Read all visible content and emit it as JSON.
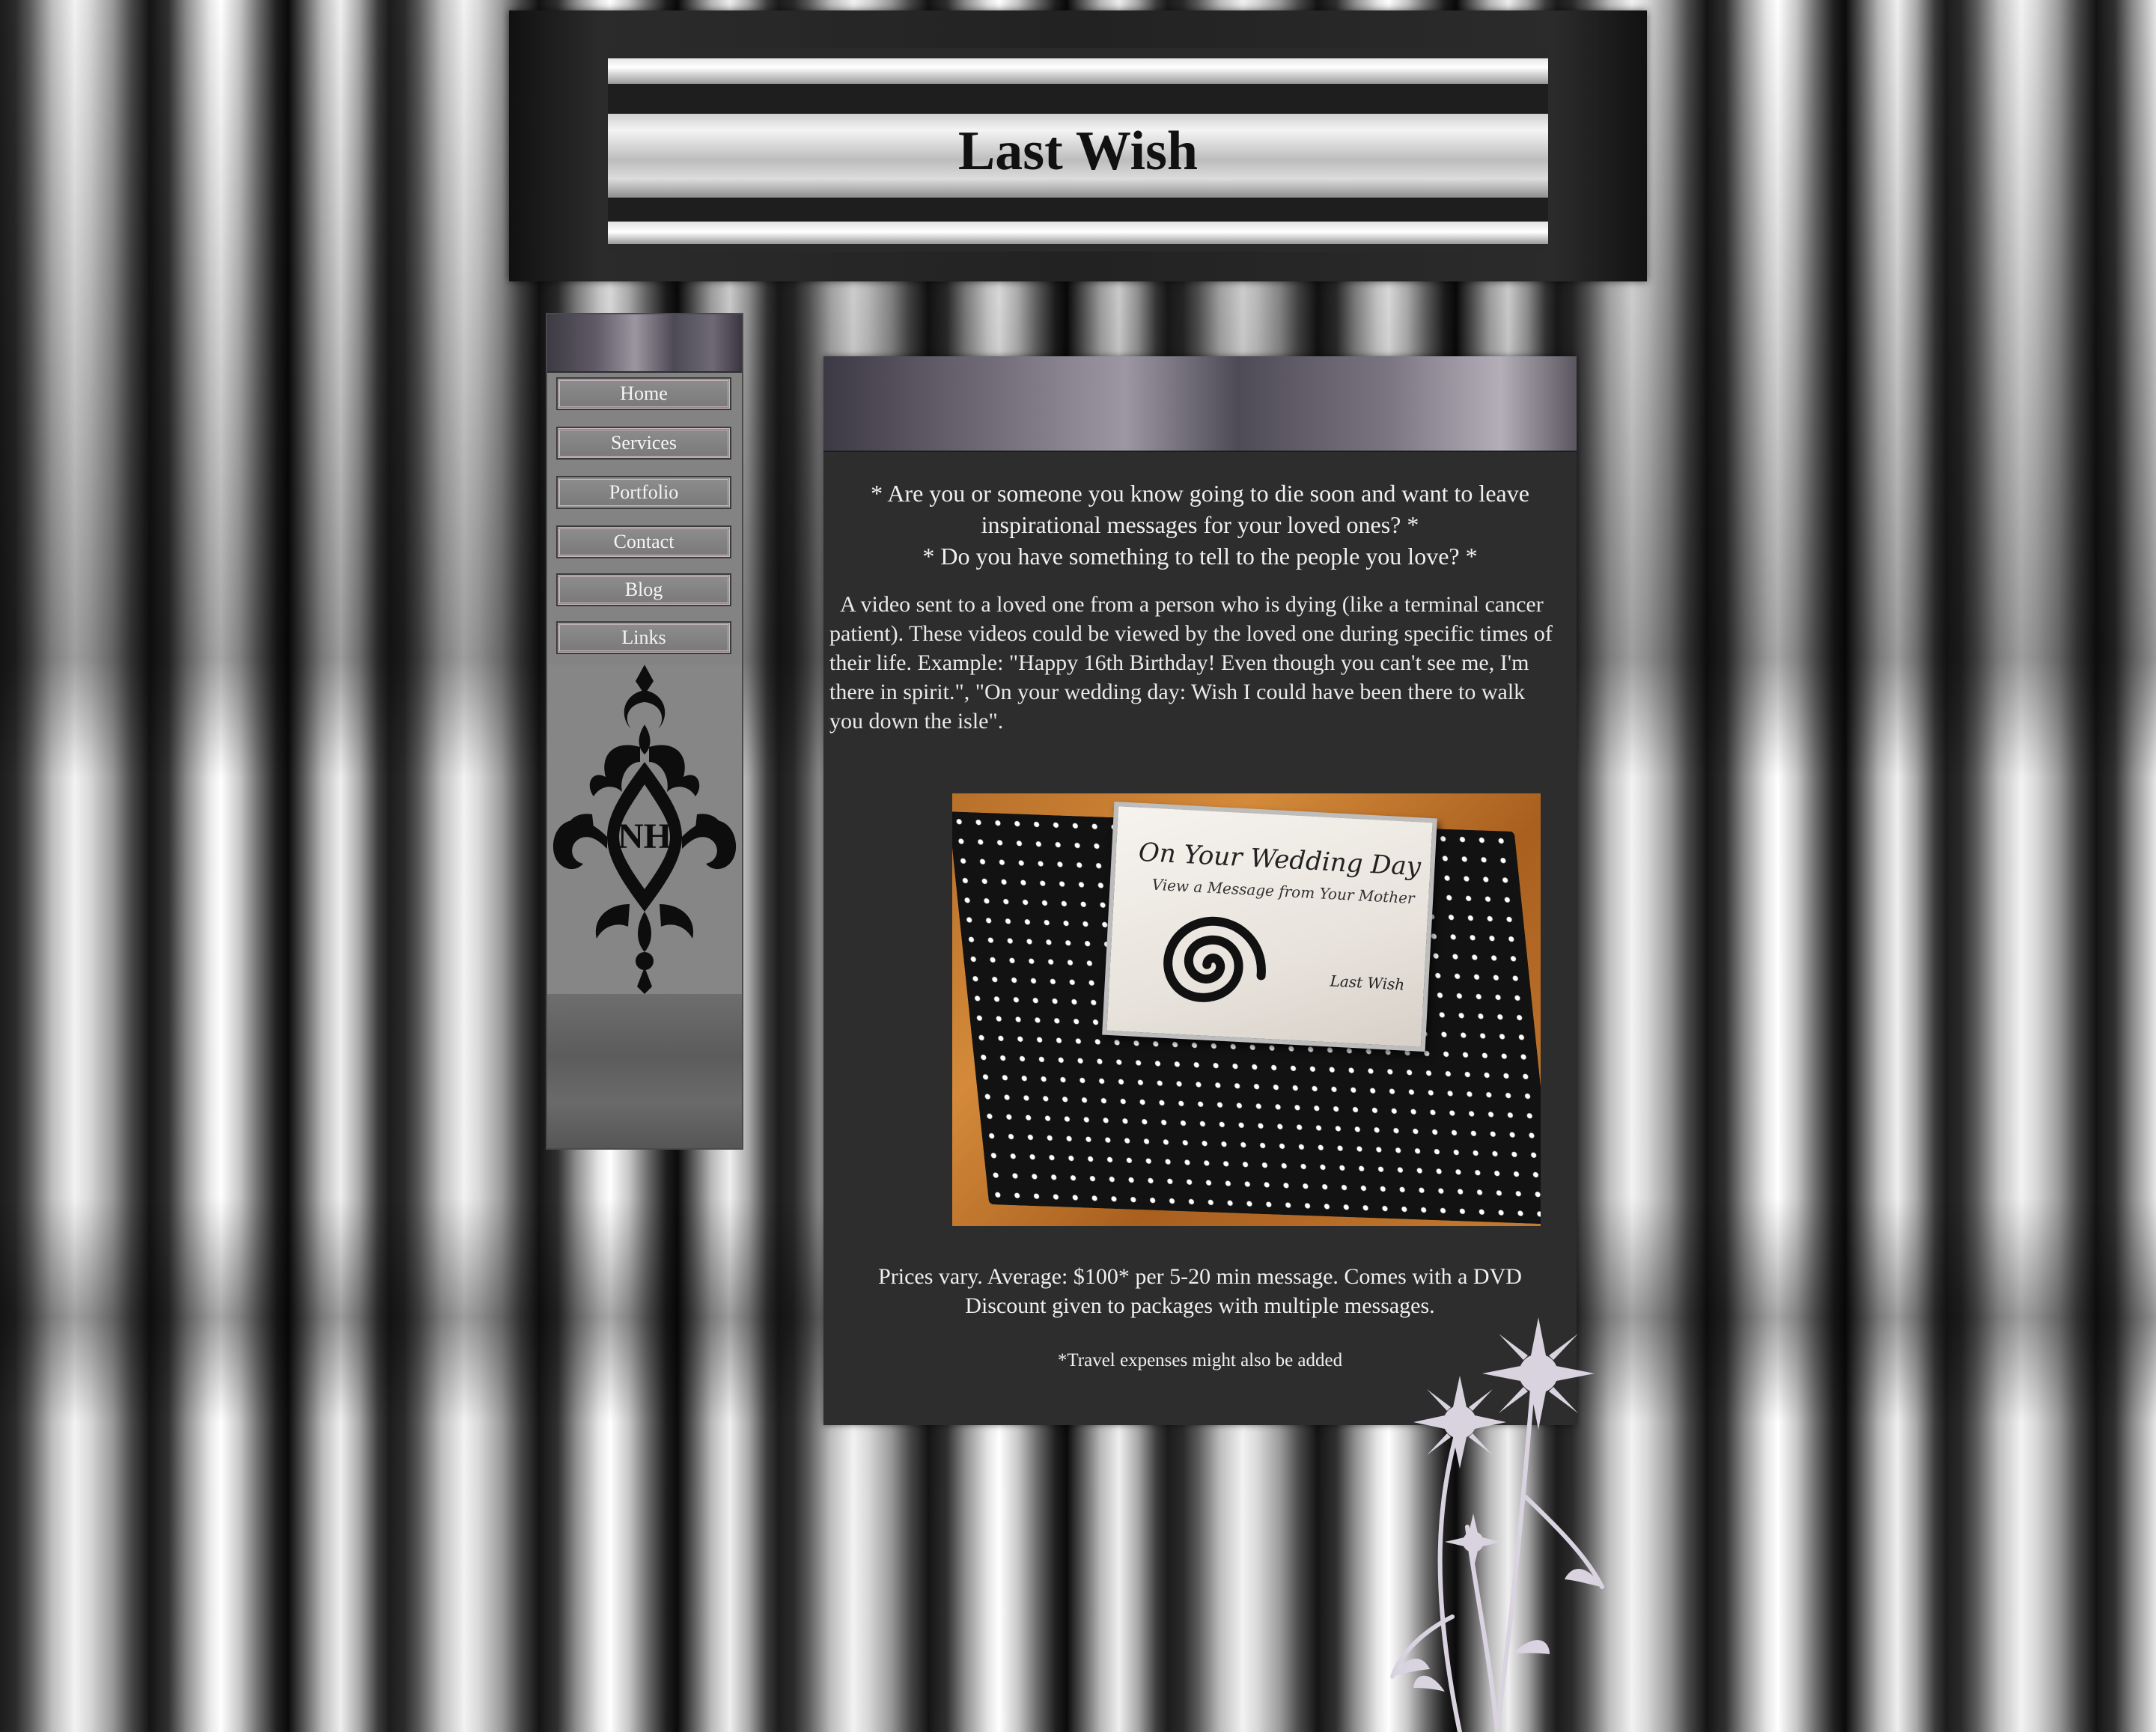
{
  "site": {
    "title": "Last Wish"
  },
  "sidebar": {
    "nav": [
      {
        "label": "Home"
      },
      {
        "label": "Services"
      },
      {
        "label": "Portfolio"
      },
      {
        "label": "Contact"
      },
      {
        "label": "Blog"
      },
      {
        "label": "Links"
      }
    ],
    "emblem_text": "NH"
  },
  "content": {
    "question_1": "* Are you or someone you know going to die soon and want to leave inspirational messages for your loved ones? *",
    "question_2": "* Do you have something to tell to the people you love? *",
    "description": "A video sent to a loved one from a person who is dying (like a terminal cancer patient). These videos could be viewed by the loved one during specific times of their life. Example: \"Happy 16th Birthday! Even though you can't see me, I'm there in spirit.\", \"On your wedding day: Wish I could have been there to walk you down the isle\".",
    "photo": {
      "case_title": "On Your Wedding Day",
      "case_subtitle": "View a Message from Your Mother",
      "case_signature": "Last Wish"
    },
    "pricing_line_1": "Prices vary. Average: $100* per 5-20 min message. Comes with a DVD",
    "pricing_line_2": "Discount given to packages with multiple messages.",
    "travel_note": "*Travel expenses might also be added"
  },
  "colors": {
    "content_bg": "#2d2d2d",
    "sidebar_bg": "#838383",
    "text_light": "#efefef",
    "nav_border": "#c9b7bf",
    "flower": "#d9d3e0"
  },
  "icons": [
    "damask-emblem-icon",
    "flower-decoration-icon",
    "swirl-icon"
  ]
}
